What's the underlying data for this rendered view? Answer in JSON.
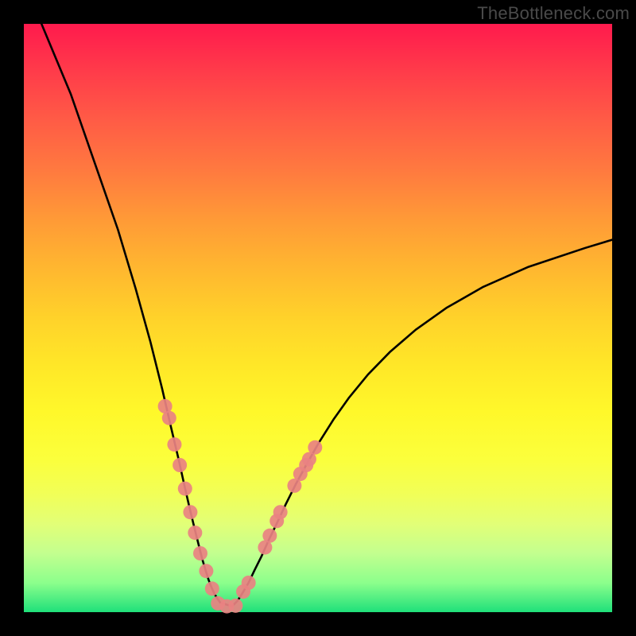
{
  "watermark": "TheBottleneck.com",
  "chart_data": {
    "type": "line",
    "title": "",
    "xlabel": "",
    "ylabel": "",
    "xlim": [
      0,
      100
    ],
    "ylim": [
      0,
      100
    ],
    "grid": false,
    "legend": false,
    "annotations": [],
    "series": [
      {
        "name": "left-arm",
        "x": [
          3,
          8,
          12,
          16,
          19,
          21.5,
          23.5,
          25,
          26.3,
          27.3,
          28.2,
          29,
          29.7,
          30.3,
          30.9,
          31.4,
          31.9,
          32.4,
          32.9,
          33.4,
          35.4
        ],
        "y": [
          100,
          88,
          76.5,
          65,
          55,
          46,
          38,
          31.5,
          26,
          21.5,
          17.6,
          14.3,
          11.5,
          9.1,
          7.1,
          5.5,
          4.2,
          3.1,
          2.3,
          1.6,
          1.0
        ]
      },
      {
        "name": "right-arm",
        "x": [
          35.4,
          36.3,
          37.2,
          38.2,
          39.2,
          40.4,
          41.6,
          43.0,
          44.5,
          46.2,
          48.1,
          50.2,
          52.6,
          55.3,
          58.5,
          62.2,
          66.6,
          71.8,
          78.1,
          85.8,
          95.4,
          100
        ],
        "y": [
          1.0,
          1.9,
          3.3,
          5.0,
          7.1,
          9.5,
          12.2,
          15.1,
          18.3,
          21.7,
          25.2,
          28.9,
          32.7,
          36.5,
          40.4,
          44.2,
          48.0,
          51.7,
          55.3,
          58.7,
          61.9,
          63.3
        ]
      }
    ],
    "markers": [
      {
        "x": 24.0,
        "y": 35.0
      },
      {
        "x": 24.7,
        "y": 33.0
      },
      {
        "x": 25.6,
        "y": 28.5
      },
      {
        "x": 26.5,
        "y": 25.0
      },
      {
        "x": 27.4,
        "y": 21.0
      },
      {
        "x": 28.3,
        "y": 17.0
      },
      {
        "x": 29.1,
        "y": 13.5
      },
      {
        "x": 30.0,
        "y": 10.0
      },
      {
        "x": 31.0,
        "y": 7.0
      },
      {
        "x": 32.0,
        "y": 4.0
      },
      {
        "x": 33.0,
        "y": 1.5
      },
      {
        "x": 34.5,
        "y": 1.0
      },
      {
        "x": 36.0,
        "y": 1.1
      },
      {
        "x": 37.3,
        "y": 3.5
      },
      {
        "x": 38.2,
        "y": 5.0
      },
      {
        "x": 41.0,
        "y": 11.0
      },
      {
        "x": 41.8,
        "y": 13.0
      },
      {
        "x": 43.0,
        "y": 15.5
      },
      {
        "x": 43.6,
        "y": 17.0
      },
      {
        "x": 46.0,
        "y": 21.5
      },
      {
        "x": 47.0,
        "y": 23.5
      },
      {
        "x": 48.0,
        "y": 25.0
      },
      {
        "x": 48.5,
        "y": 26.0
      },
      {
        "x": 49.5,
        "y": 28.0
      }
    ],
    "marker_style": {
      "color": "#e98282",
      "radius_px": 9
    }
  }
}
